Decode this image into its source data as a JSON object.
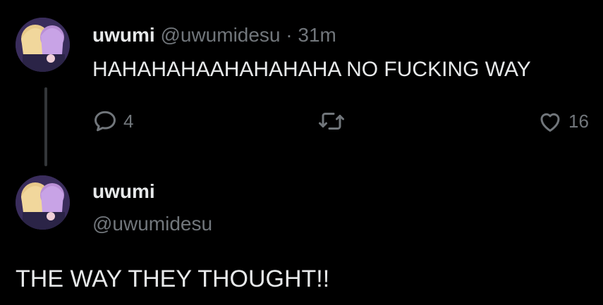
{
  "tweet1": {
    "display_name": "uwumi",
    "handle": "@uwumidesu",
    "separator": "·",
    "time": "31m",
    "text": "HAHAHAHAAHAHAHAHA NO FUCKING WAY",
    "reply_count": "4",
    "like_count": "16",
    "icons": [
      "reply-icon",
      "retweet-icon",
      "like-icon"
    ]
  },
  "tweet2": {
    "display_name": "uwumi",
    "handle": "@uwumidesu",
    "text": "THE WAY THEY THOUGHT!!"
  },
  "colors": {
    "background": "#000000",
    "text": "#e7e9ea",
    "muted": "#71767b",
    "thread_line": "#333639"
  }
}
